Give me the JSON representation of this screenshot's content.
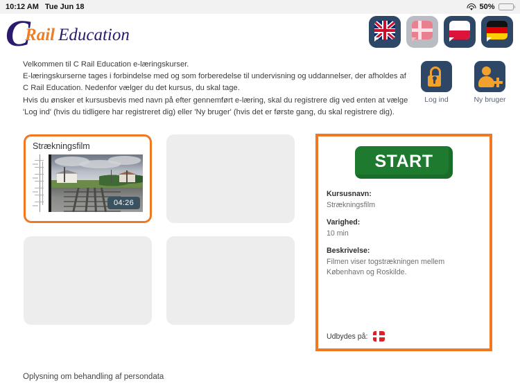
{
  "status_bar": {
    "time": "10:12 AM",
    "date": "Tue Jun 18",
    "wifi_icon": "wifi-icon",
    "battery_percent": "50%",
    "battery_icon": "battery-charging-icon"
  },
  "header": {
    "logo": {
      "c": "C",
      "rail": "Rail",
      "education": "Education"
    },
    "languages": [
      {
        "name": "english",
        "flag": "uk-flag-icon",
        "selected": false
      },
      {
        "name": "danish",
        "flag": "denmark-flag-icon",
        "selected": true
      },
      {
        "name": "polish",
        "flag": "poland-flag-icon",
        "selected": false
      },
      {
        "name": "german",
        "flag": "germany-flag-icon",
        "selected": false
      }
    ]
  },
  "intro": {
    "line1": "Velkommen til C Rail Education e-læringskurser.",
    "line2": "E-læringskurserne tages i forbindelse med og som forberedelse til undervisning og uddannelser, der afholdes af C Rail Education. Nedenfor vælger du det kursus, du skal tage.",
    "line3": "Hvis du ønsker et kursusbevis med navn på efter gennemført e-læring, skal du registrere dig ved enten at vælge 'Log ind' (hvis du tidligere har registreret dig) eller 'Ny bruger' (hvis det er første gang, du skal registrere dig)."
  },
  "account": {
    "login": {
      "label": "Log ind",
      "icon": "padlock-open-icon"
    },
    "new_user": {
      "label": "Ny bruger",
      "icon": "user-plus-icon"
    }
  },
  "courses": [
    {
      "title": "Strækningsfilm",
      "duration_badge": "04:26",
      "selected": true,
      "thumbnail": "railway-track-video-thumbnail"
    },
    {
      "title": "",
      "duration_badge": "",
      "selected": false,
      "thumbnail": ""
    },
    {
      "title": "",
      "duration_badge": "",
      "selected": false,
      "thumbnail": ""
    },
    {
      "title": "",
      "duration_badge": "",
      "selected": false,
      "thumbnail": ""
    }
  ],
  "detail": {
    "start_label": "START",
    "fields": [
      {
        "label": "Kursusnavn:",
        "value": "Strækningsfilm"
      },
      {
        "label": "Varighed:",
        "value": "10 min"
      },
      {
        "label": "Beskrivelse:",
        "value": "Filmen viser togstrækningen mellem København og Roskilde."
      }
    ],
    "offered_label": "Udbydes på:",
    "offered_flag": "denmark-flag-icon"
  },
  "footer": {
    "privacy_link": "Oplysning om behandling af persondata"
  },
  "colors": {
    "accent_orange": "#f07822",
    "logo_orange": "#ef7d22",
    "logo_navy": "#2b1a6e",
    "icon_navy": "#2e4766",
    "icon_orange": "#f2a22c",
    "start_green": "#1d7a2e",
    "card_grey": "#ededed",
    "badge_slate": "#3a5260"
  }
}
